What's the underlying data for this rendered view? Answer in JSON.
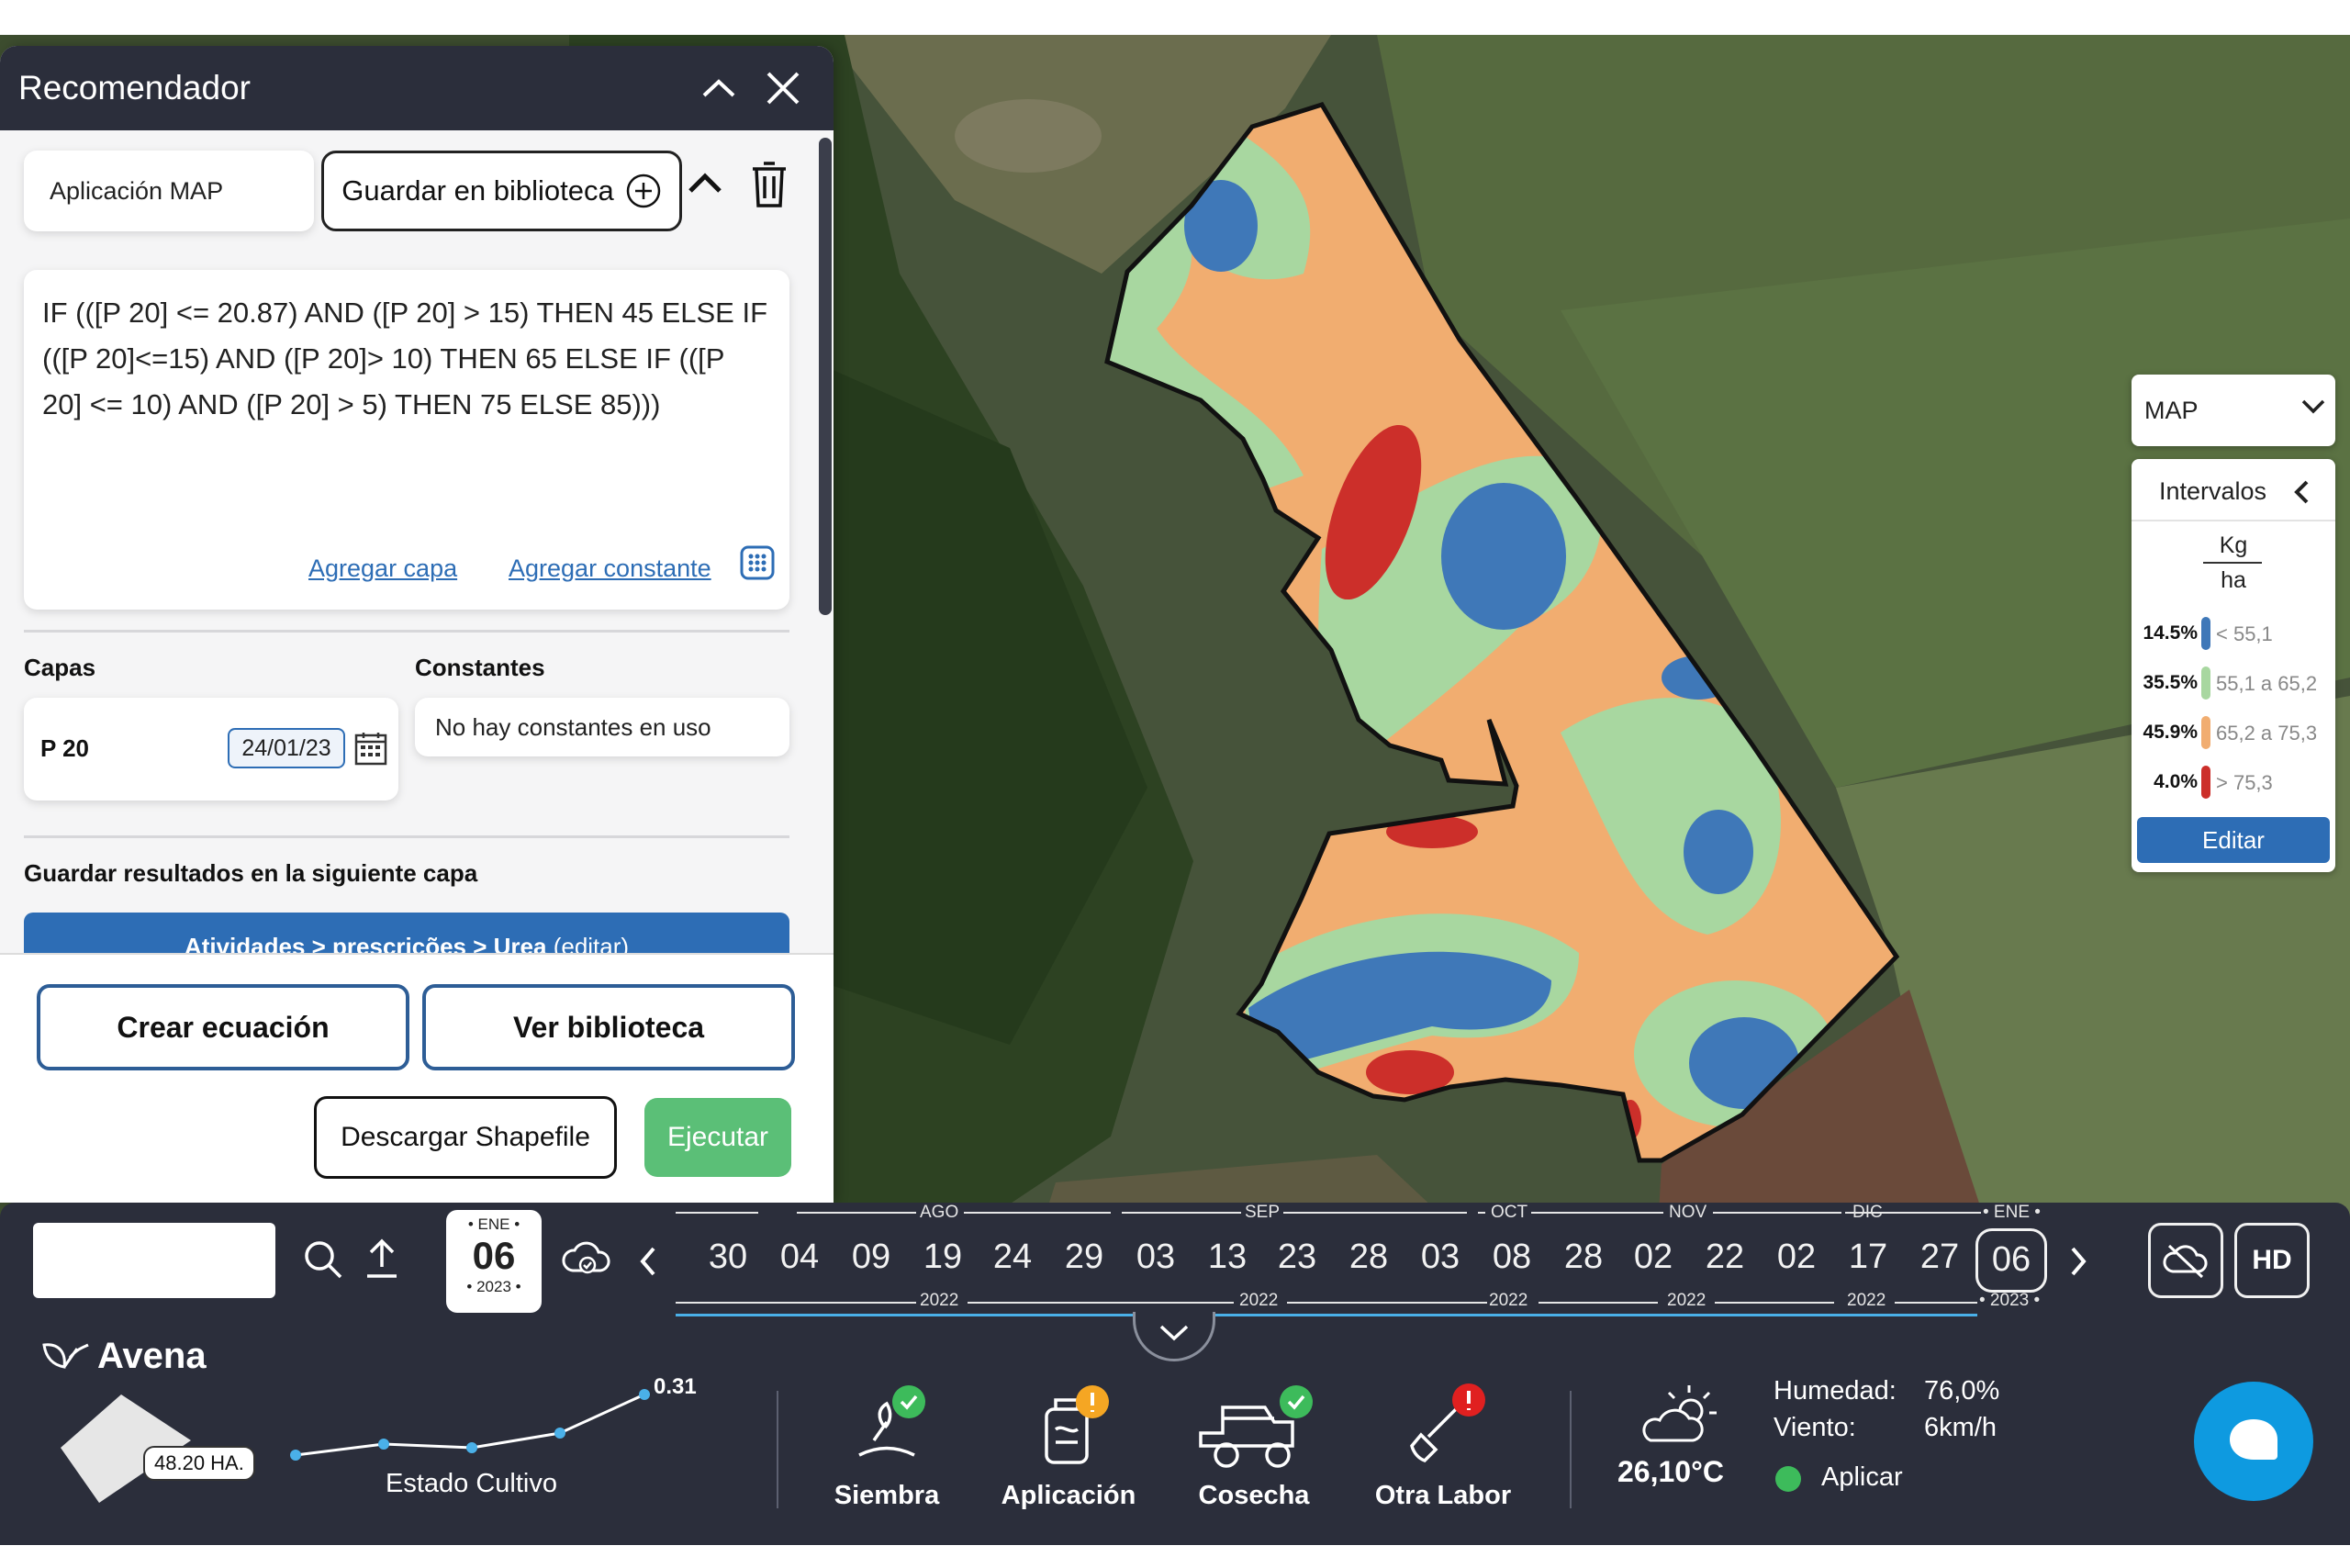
{
  "panel": {
    "title": "Recomendador",
    "app_chip": "Aplicación MAP",
    "save_library": "Guardar en biblioteca",
    "equation": "IF (([P 20] <= 20.87) AND ([P 20] > 15) THEN 45 ELSE IF (([P 20]<=15) AND ([P 20]> 10) THEN 65 ELSE IF (([P 20] <= 10) AND ([P 20] > 5) THEN 75 ELSE 85)))",
    "add_layer": "Agregar capa",
    "add_constant": "Agregar constante",
    "layers_label": "Capas",
    "constants_label": "Constantes",
    "layer_name": "P 20",
    "layer_date": "24/01/23",
    "no_constants": "No hay constantes en uso",
    "save_results_label": "Guardar resultados en la siguiente capa",
    "destination": "Atividades > prescrições > Urea",
    "destination_edit": "(editar)",
    "create_equation": "Crear ecuación",
    "view_library": "Ver biblioteca",
    "download_shapefile": "Descargar Shapefile",
    "execute": "Ejecutar"
  },
  "legend": {
    "layer_select": "MAP",
    "title": "Intervalos",
    "unit_num": "Kg",
    "unit_den": "ha",
    "rows": [
      {
        "pct": "14.5%",
        "range": "< 55,1",
        "color": "#3f78b8"
      },
      {
        "pct": "35.5%",
        "range": "55,1 a 65,2",
        "color": "#a8d7a0"
      },
      {
        "pct": "45.9%",
        "range": "65,2 a 75,3",
        "color": "#f1ad70"
      },
      {
        "pct": "4.0%",
        "range": "> 75,3",
        "color": "#cc2f2a"
      }
    ],
    "edit": "Editar"
  },
  "timeline": {
    "current": {
      "month": "• ENE •",
      "day": "06",
      "year": "• 2023 •"
    },
    "days": [
      "30",
      "04",
      "09",
      "19",
      "24",
      "29",
      "03",
      "13",
      "23",
      "28",
      "03",
      "08",
      "28",
      "02",
      "22",
      "02",
      "17",
      "27",
      "06"
    ],
    "months": [
      "AGO",
      "SEP",
      "OCT",
      "NOV",
      "DIC",
      "• ENE •"
    ],
    "years": [
      "2022",
      "2022",
      "2022",
      "2022",
      "2022",
      "• 2023 •"
    ],
    "hd": "HD"
  },
  "info": {
    "crop": "Avena",
    "area": "48.20 HA.",
    "trend_value": "0.31",
    "trend_label": "Estado Cultivo",
    "activities": [
      {
        "label": "Siembra",
        "status": "ok"
      },
      {
        "label": "Aplicación",
        "status": "warning"
      },
      {
        "label": "Cosecha",
        "status": "ok"
      },
      {
        "label": "Otra Labor",
        "status": "alert"
      }
    ],
    "temperature": "26,10°C",
    "humidity_label": "Humedad:",
    "humidity": "76,0%",
    "wind_label": "Viento:",
    "wind": "6km/h",
    "apply": "Aplicar"
  },
  "colors": {
    "panel_dark": "#2b2e3b",
    "accent_blue": "#2d6db5",
    "execute_green": "#5bbf77",
    "chat_blue": "#0e9ae0"
  }
}
